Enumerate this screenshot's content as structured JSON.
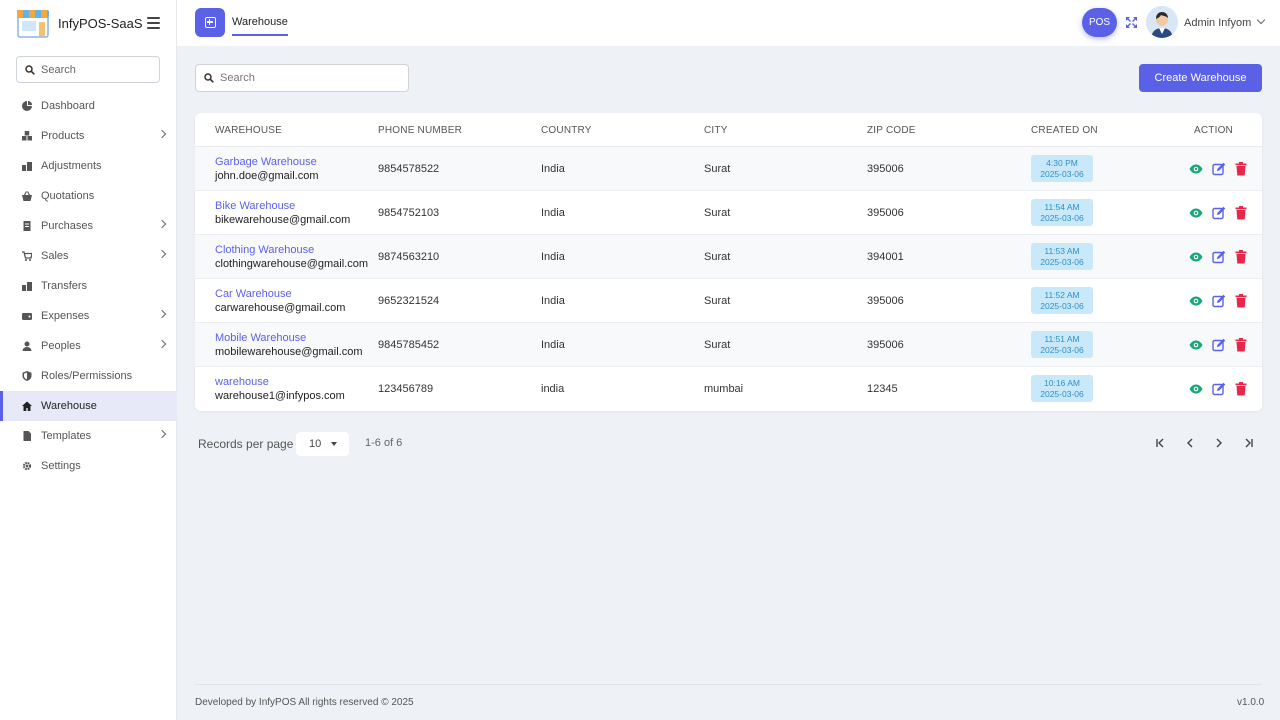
{
  "brand": {
    "name": "InfyPOS-SaaS"
  },
  "sidebar": {
    "search_placeholder": "Search",
    "items": [
      {
        "label": "Dashboard",
        "icon": "pie-chart-icon",
        "has_children": false,
        "active": false
      },
      {
        "label": "Products",
        "icon": "boxes-icon",
        "has_children": true,
        "active": false
      },
      {
        "label": "Adjustments",
        "icon": "adjust-icon",
        "has_children": false,
        "active": false
      },
      {
        "label": "Quotations",
        "icon": "basket-icon",
        "has_children": false,
        "active": false
      },
      {
        "label": "Purchases",
        "icon": "receipt-icon",
        "has_children": true,
        "active": false
      },
      {
        "label": "Sales",
        "icon": "cart-icon",
        "has_children": true,
        "active": false
      },
      {
        "label": "Transfers",
        "icon": "transfer-icon",
        "has_children": false,
        "active": false
      },
      {
        "label": "Expenses",
        "icon": "wallet-icon",
        "has_children": true,
        "active": false
      },
      {
        "label": "Peoples",
        "icon": "user-icon",
        "has_children": true,
        "active": false
      },
      {
        "label": "Roles/Permissions",
        "icon": "shield-icon",
        "has_children": false,
        "active": false
      },
      {
        "label": "Warehouse",
        "icon": "home-icon",
        "has_children": false,
        "active": true
      },
      {
        "label": "Templates",
        "icon": "file-icon",
        "has_children": true,
        "active": false
      },
      {
        "label": "Settings",
        "icon": "gear-icon",
        "has_children": false,
        "active": false
      }
    ]
  },
  "header": {
    "tab_label": "Warehouse",
    "pos_label": "POS",
    "user_name": "Admin Infyom"
  },
  "toolbar": {
    "search_placeholder": "Search",
    "create_label": "Create Warehouse"
  },
  "table": {
    "columns": [
      "WAREHOUSE",
      "PHONE NUMBER",
      "COUNTRY",
      "CITY",
      "ZIP CODE",
      "CREATED ON",
      "ACTION"
    ],
    "rows": [
      {
        "name": "Garbage Warehouse",
        "email": "john.doe@gmail.com",
        "phone": "9854578522",
        "country": "India",
        "city": "Surat",
        "zip": "395006",
        "time": "4:30 PM",
        "date": "2025-03-06"
      },
      {
        "name": "Bike Warehouse",
        "email": "bikewarehouse@gmail.com",
        "phone": "9854752103",
        "country": "India",
        "city": "Surat",
        "zip": "395006",
        "time": "11:54 AM",
        "date": "2025-03-06"
      },
      {
        "name": "Clothing Warehouse",
        "email": "clothingwarehouse@gmail.com",
        "phone": "9874563210",
        "country": "India",
        "city": "Surat",
        "zip": "394001",
        "time": "11:53 AM",
        "date": "2025-03-06"
      },
      {
        "name": "Car Warehouse",
        "email": "carwarehouse@gmail.com",
        "phone": "9652321524",
        "country": "India",
        "city": "Surat",
        "zip": "395006",
        "time": "11:52 AM",
        "date": "2025-03-06"
      },
      {
        "name": "Mobile Warehouse",
        "email": "mobilewarehouse@gmail.com",
        "phone": "9845785452",
        "country": "India",
        "city": "Surat",
        "zip": "395006",
        "time": "11:51 AM",
        "date": "2025-03-06"
      },
      {
        "name": "warehouse",
        "email": "warehouse1@infypos.com",
        "phone": "123456789",
        "country": "india",
        "city": "mumbai",
        "zip": "12345",
        "time": "10:16 AM",
        "date": "2025-03-06"
      }
    ]
  },
  "pagination": {
    "records_label": "Records per page",
    "per_page": "10",
    "range": "1-6 of 6"
  },
  "footer": {
    "text": "Developed by InfyPOS All rights reserved © 2025",
    "version": "v1.0.0"
  },
  "colors": {
    "accent": "#5b61e6",
    "view": "#1aa876",
    "edit": "#5b61e6",
    "delete": "#e8264a",
    "badge_bg": "#c9e9fb",
    "badge_text": "#2f8fc7"
  }
}
